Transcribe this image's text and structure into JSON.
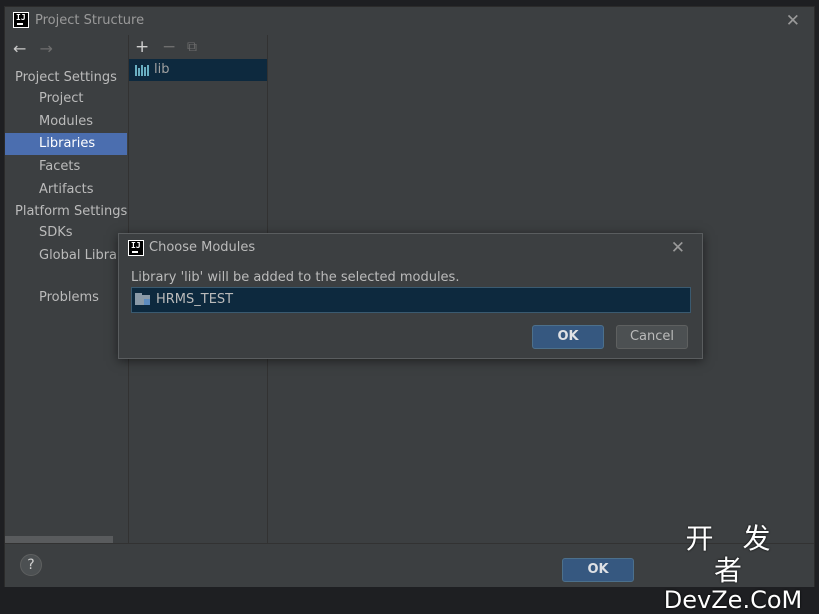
{
  "window": {
    "title": "Project Structure",
    "close_glyph": "✕"
  },
  "nav": {
    "back": "←",
    "forward": "→",
    "project_settings_header": "Project Settings",
    "project_items": [
      "Project",
      "Modules",
      "Libraries",
      "Facets",
      "Artifacts"
    ],
    "platform_settings_header": "Platform Settings",
    "platform_items": [
      "SDKs",
      "Global Libraries"
    ],
    "other_items": [
      "Problems"
    ],
    "selected": "Libraries"
  },
  "libraries": {
    "toolbar": {
      "add": "+",
      "remove": "−",
      "copy": "⧉"
    },
    "items": [
      "lib"
    ]
  },
  "bottom": {
    "help_label": "?",
    "ok_label": "OK"
  },
  "watermark": {
    "line1": "开 发 者",
    "line2": "DevZe.CoM"
  },
  "dialog": {
    "title": "Choose Modules",
    "close_glyph": "✕",
    "message": "Library 'lib' will be added to the selected modules.",
    "modules": [
      "HRMS_TEST"
    ],
    "ok_label": "OK",
    "cancel_label": "Cancel"
  },
  "colors": {
    "background": "#3c3f41",
    "selection": "#4b6eaf",
    "list_selection": "#0d293e",
    "primary_button": "#365880"
  }
}
